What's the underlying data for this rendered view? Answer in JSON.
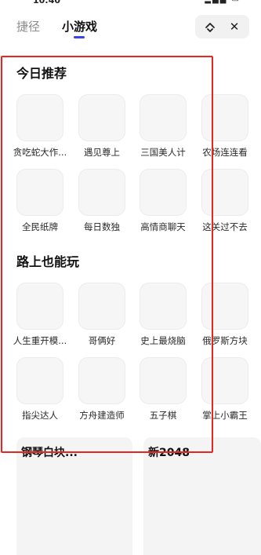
{
  "tabs": [
    {
      "label": "捷径"
    },
    {
      "label": "小游戏"
    }
  ],
  "capsule": {
    "refresh_icon": "refresh-icon",
    "close_label": "✕"
  },
  "sections": [
    {
      "title": "今日推荐",
      "games": [
        "贪吃蛇大作...",
        "遇见尊上",
        "三国美人计",
        "农场连连看",
        "全民纸牌",
        "每日数独",
        "高情商聊天",
        "这关过不去"
      ]
    },
    {
      "title": "路上也能玩",
      "games": [
        "人生重开模...",
        "哥俩好",
        "史上最烧脑",
        "俄罗斯方块",
        "指尖达人",
        "方舟建造师",
        "五子棋",
        "掌上小霸王"
      ]
    }
  ],
  "cards": [
    {
      "title": "钢琴白块..."
    },
    {
      "title": "新2048"
    }
  ],
  "colors": {
    "accent": "#3a43e8",
    "highlight": "#e8251f"
  }
}
